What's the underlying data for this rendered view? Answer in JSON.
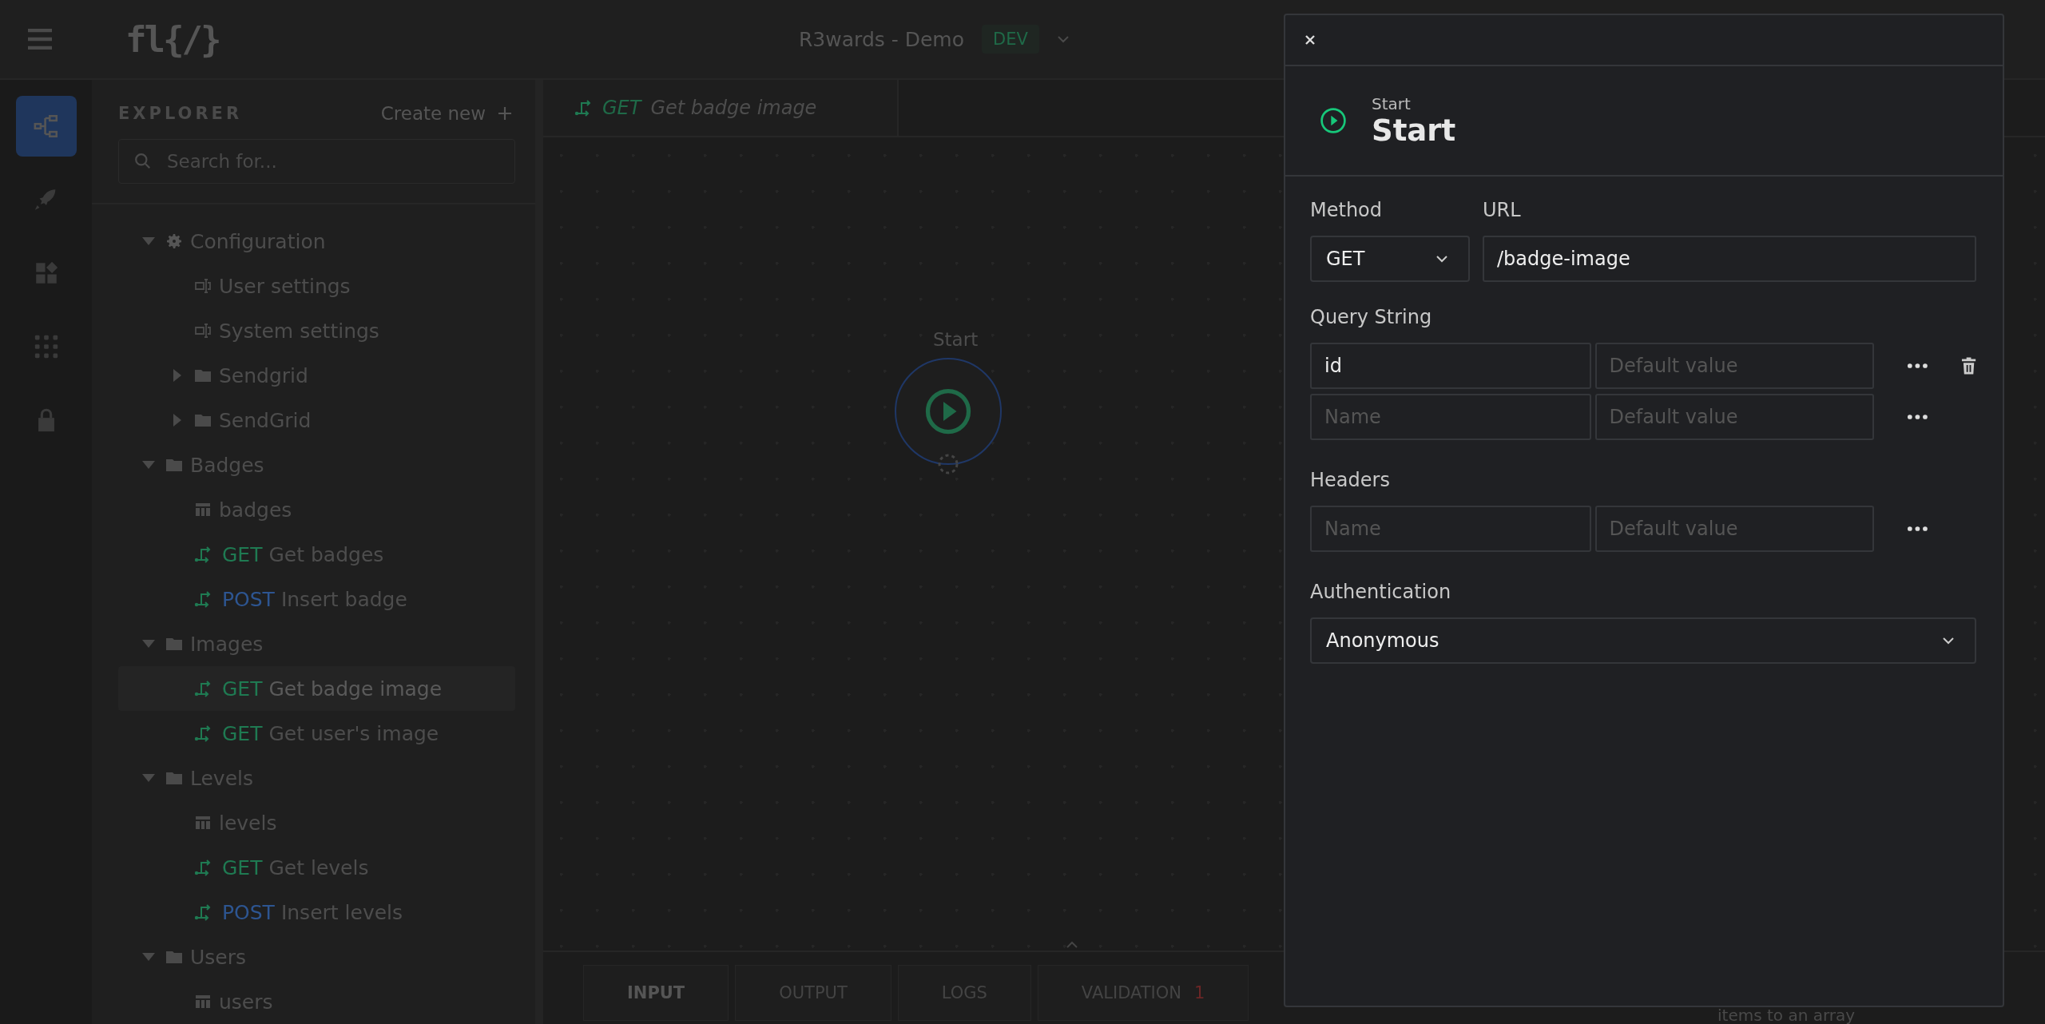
{
  "header": {
    "logo": "fl{/}",
    "project": "R3wards - Demo",
    "environment": "DEV"
  },
  "rail": [
    {
      "kind": "flow",
      "selected": true
    },
    {
      "kind": "deploy",
      "selected": false
    },
    {
      "kind": "components",
      "selected": false
    },
    {
      "kind": "apps",
      "selected": false
    },
    {
      "kind": "security",
      "selected": false
    }
  ],
  "explorer": {
    "title": "EXPLORER",
    "create_new": "Create new",
    "search": {
      "placeholder": "Search for..."
    },
    "tree": [
      {
        "kind": "config",
        "label": "Configuration",
        "expanded": true,
        "selected": false,
        "children": [
          {
            "kind": "settings",
            "label": "User settings",
            "selected": false
          },
          {
            "kind": "settings",
            "label": "System settings",
            "selected": false
          },
          {
            "kind": "folder",
            "label": "Sendgrid",
            "expanded": false,
            "selected": false
          },
          {
            "kind": "folder",
            "label": "SendGrid",
            "expanded": false,
            "selected": false
          }
        ]
      },
      {
        "kind": "folder",
        "label": "Badges",
        "expanded": true,
        "selected": false,
        "children": [
          {
            "kind": "table",
            "label": "badges",
            "selected": false
          },
          {
            "kind": "endpoint",
            "method": "GET",
            "color": "#1f7a52",
            "label": "Get badges",
            "selected": false
          },
          {
            "kind": "endpoint",
            "method": "POST",
            "color": "#2d5591",
            "label": "Insert badge",
            "selected": false
          }
        ]
      },
      {
        "kind": "folder",
        "label": "Images",
        "expanded": true,
        "selected": false,
        "children": [
          {
            "kind": "endpoint",
            "method": "GET",
            "color": "#1f7a52",
            "label": "Get badge image",
            "selected": true
          },
          {
            "kind": "endpoint",
            "method": "GET",
            "color": "#1f7a52",
            "label": "Get user's image",
            "selected": false
          }
        ]
      },
      {
        "kind": "folder",
        "label": "Levels",
        "expanded": true,
        "selected": false,
        "children": [
          {
            "kind": "table",
            "label": "levels",
            "selected": false
          },
          {
            "kind": "endpoint",
            "method": "GET",
            "color": "#1f7a52",
            "label": "Get levels",
            "selected": false
          },
          {
            "kind": "endpoint",
            "method": "POST",
            "color": "#2d5591",
            "label": "Insert levels",
            "selected": false
          }
        ]
      },
      {
        "kind": "folder",
        "label": "Users",
        "expanded": true,
        "selected": false,
        "children": [
          {
            "kind": "table",
            "label": "users",
            "selected": false
          }
        ]
      }
    ]
  },
  "editor_tab": {
    "method": "GET",
    "label": "Get badge image"
  },
  "canvas": {
    "node_label": "Start",
    "hint": "items to an array"
  },
  "bottom_tabs": [
    {
      "label": "INPUT",
      "selected": true
    },
    {
      "label": "OUTPUT",
      "selected": false
    },
    {
      "label": "LOGS",
      "selected": false
    },
    {
      "label": "VALIDATION",
      "selected": false,
      "count": "1"
    }
  ],
  "drawer": {
    "subtitle": "Start",
    "title": "Start",
    "method": {
      "label": "Method",
      "value": "GET"
    },
    "url": {
      "label": "URL",
      "value": "/badge-image"
    },
    "query_string": {
      "label": "Query String",
      "rows": [
        {
          "name": "id",
          "default_placeholder": "Default value",
          "deletable": true
        },
        {
          "name_placeholder": "Name",
          "default_placeholder": "Default value",
          "deletable": false
        }
      ]
    },
    "headers": {
      "label": "Headers",
      "rows": [
        {
          "name_placeholder": "Name",
          "default_placeholder": "Default value",
          "deletable": false
        }
      ]
    },
    "authentication": {
      "label": "Authentication",
      "value": "Anonymous"
    }
  }
}
